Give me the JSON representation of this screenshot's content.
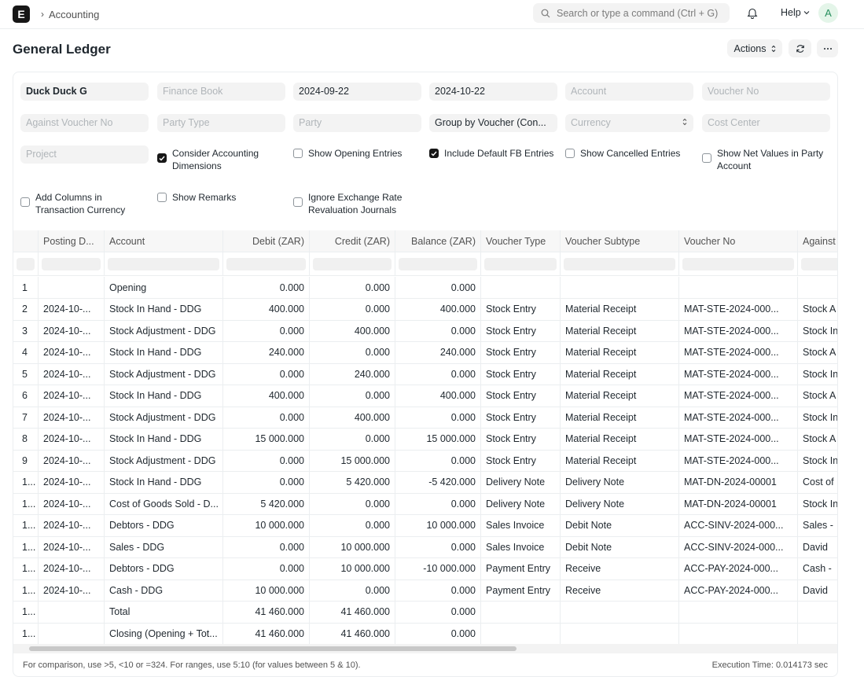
{
  "navbar": {
    "logo_letter": "E",
    "breadcrumb": "Accounting",
    "search_placeholder": "Search or type a command (Ctrl + G)",
    "help_label": "Help",
    "avatar_letter": "A"
  },
  "page": {
    "title": "General Ledger",
    "actions_label": "Actions"
  },
  "filters": {
    "company": "Duck Duck G",
    "finance_book": "Finance Book",
    "from_date": "2024-09-22",
    "to_date": "2024-10-22",
    "account": "Account",
    "voucher_no": "Voucher No",
    "against_voucher_no": "Against Voucher No",
    "party_type": "Party Type",
    "party": "Party",
    "group_by": "Group by Voucher (Con...",
    "currency": "Currency",
    "cost_center": "Cost Center",
    "project": "Project"
  },
  "checks": {
    "consider_dims": "Consider Accounting Dimensions",
    "show_opening": "Show Opening Entries",
    "include_fb": "Include Default FB Entries",
    "show_cancelled": "Show Cancelled Entries",
    "net_values": "Show Net Values in Party Account",
    "add_columns": "Add Columns in Transaction Currency",
    "show_remarks": "Show Remarks",
    "ignore_exchange": "Ignore Exchange Rate Revaluation Journals"
  },
  "table": {
    "headers": [
      "Posting D...",
      "Account",
      "Debit (ZAR)",
      "Credit (ZAR)",
      "Balance (ZAR)",
      "Voucher Type",
      "Voucher Subtype",
      "Voucher No",
      "Against"
    ],
    "rows": [
      {
        "idx": "1",
        "date": "",
        "account": "Opening",
        "debit": "0.000",
        "credit": "0.000",
        "balance": "0.000",
        "vtype": "",
        "vsub": "",
        "vno": "",
        "against": ""
      },
      {
        "idx": "2",
        "date": "2024-10-...",
        "account": "Stock In Hand - DDG",
        "debit": "400.000",
        "credit": "0.000",
        "balance": "400.000",
        "vtype": "Stock Entry",
        "vsub": "Material Receipt",
        "vno": "MAT-STE-2024-000...",
        "against": "Stock A"
      },
      {
        "idx": "3",
        "date": "2024-10-...",
        "account": "Stock Adjustment - DDG",
        "debit": "0.000",
        "credit": "400.000",
        "balance": "0.000",
        "vtype": "Stock Entry",
        "vsub": "Material Receipt",
        "vno": "MAT-STE-2024-000...",
        "against": "Stock In"
      },
      {
        "idx": "4",
        "date": "2024-10-...",
        "account": "Stock In Hand - DDG",
        "debit": "240.000",
        "credit": "0.000",
        "balance": "240.000",
        "vtype": "Stock Entry",
        "vsub": "Material Receipt",
        "vno": "MAT-STE-2024-000...",
        "against": "Stock A"
      },
      {
        "idx": "5",
        "date": "2024-10-...",
        "account": "Stock Adjustment - DDG",
        "debit": "0.000",
        "credit": "240.000",
        "balance": "0.000",
        "vtype": "Stock Entry",
        "vsub": "Material Receipt",
        "vno": "MAT-STE-2024-000...",
        "against": "Stock In"
      },
      {
        "idx": "6",
        "date": "2024-10-...",
        "account": "Stock In Hand - DDG",
        "debit": "400.000",
        "credit": "0.000",
        "balance": "400.000",
        "vtype": "Stock Entry",
        "vsub": "Material Receipt",
        "vno": "MAT-STE-2024-000...",
        "against": "Stock A"
      },
      {
        "idx": "7",
        "date": "2024-10-...",
        "account": "Stock Adjustment - DDG",
        "debit": "0.000",
        "credit": "400.000",
        "balance": "0.000",
        "vtype": "Stock Entry",
        "vsub": "Material Receipt",
        "vno": "MAT-STE-2024-000...",
        "against": "Stock In"
      },
      {
        "idx": "8",
        "date": "2024-10-...",
        "account": "Stock In Hand - DDG",
        "debit": "15 000.000",
        "credit": "0.000",
        "balance": "15 000.000",
        "vtype": "Stock Entry",
        "vsub": "Material Receipt",
        "vno": "MAT-STE-2024-000...",
        "against": "Stock A"
      },
      {
        "idx": "9",
        "date": "2024-10-...",
        "account": "Stock Adjustment - DDG",
        "debit": "0.000",
        "credit": "15 000.000",
        "balance": "0.000",
        "vtype": "Stock Entry",
        "vsub": "Material Receipt",
        "vno": "MAT-STE-2024-000...",
        "against": "Stock In"
      },
      {
        "idx": "1...",
        "date": "2024-10-...",
        "account": "Stock In Hand - DDG",
        "debit": "0.000",
        "credit": "5 420.000",
        "balance": "-5 420.000",
        "vtype": "Delivery Note",
        "vsub": "Delivery Note",
        "vno": "MAT-DN-2024-00001",
        "against": "Cost of"
      },
      {
        "idx": "1...",
        "date": "2024-10-...",
        "account": "Cost of Goods Sold - D...",
        "debit": "5 420.000",
        "credit": "0.000",
        "balance": "0.000",
        "vtype": "Delivery Note",
        "vsub": "Delivery Note",
        "vno": "MAT-DN-2024-00001",
        "against": "Stock In"
      },
      {
        "idx": "1...",
        "date": "2024-10-...",
        "account": "Debtors - DDG",
        "debit": "10 000.000",
        "credit": "0.000",
        "balance": "10 000.000",
        "vtype": "Sales Invoice",
        "vsub": "Debit Note",
        "vno": "ACC-SINV-2024-000...",
        "against": "Sales -"
      },
      {
        "idx": "1...",
        "date": "2024-10-...",
        "account": "Sales - DDG",
        "debit": "0.000",
        "credit": "10 000.000",
        "balance": "0.000",
        "vtype": "Sales Invoice",
        "vsub": "Debit Note",
        "vno": "ACC-SINV-2024-000...",
        "against": "David"
      },
      {
        "idx": "1...",
        "date": "2024-10-...",
        "account": "Debtors - DDG",
        "debit": "0.000",
        "credit": "10 000.000",
        "balance": "-10 000.000",
        "vtype": "Payment Entry",
        "vsub": "Receive",
        "vno": "ACC-PAY-2024-000...",
        "against": "Cash -"
      },
      {
        "idx": "1...",
        "date": "2024-10-...",
        "account": "Cash - DDG",
        "debit": "10 000.000",
        "credit": "0.000",
        "balance": "0.000",
        "vtype": "Payment Entry",
        "vsub": "Receive",
        "vno": "ACC-PAY-2024-000...",
        "against": "David"
      },
      {
        "idx": "1...",
        "date": "",
        "account": "Total",
        "debit": "41 460.000",
        "credit": "41 460.000",
        "balance": "0.000",
        "vtype": "",
        "vsub": "",
        "vno": "",
        "against": ""
      },
      {
        "idx": "1...",
        "date": "",
        "account": "Closing (Opening + Tot...",
        "debit": "41 460.000",
        "credit": "41 460.000",
        "balance": "0.000",
        "vtype": "",
        "vsub": "",
        "vno": "",
        "against": ""
      }
    ]
  },
  "footer": {
    "note": "For comparison, use >5, <10 or =324. For ranges, use 5:10 (for values between 5 & 10).",
    "exec_time": "Execution Time: 0.014173 sec"
  }
}
